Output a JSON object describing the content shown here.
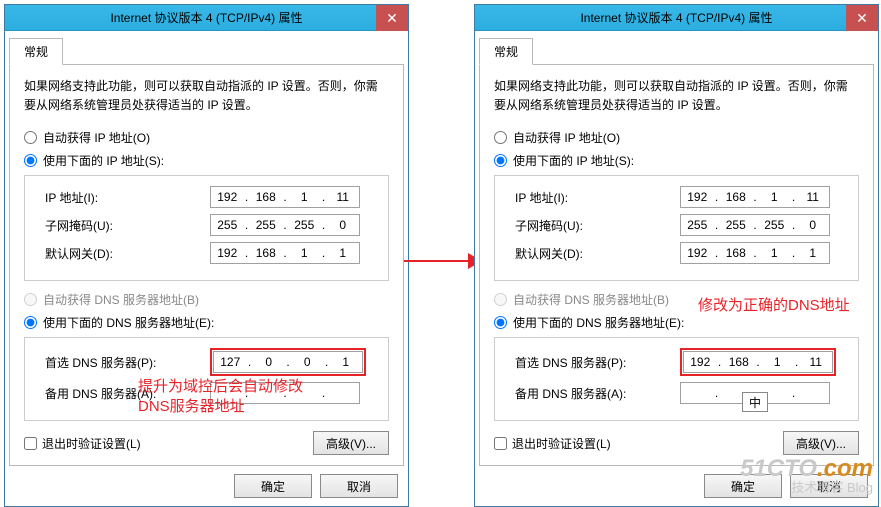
{
  "title": "Internet 协议版本 4 (TCP/IPv4) 属性",
  "tab_general": "常规",
  "desc": "如果网络支持此功能，则可以获取自动指派的 IP 设置。否则，你需要从网络系统管理员处获得适当的 IP 设置。",
  "radio_auto_ip": "自动获得 IP 地址(O)",
  "radio_manual_ip": "使用下面的 IP 地址(S):",
  "lbl_ip": "IP 地址(I):",
  "lbl_mask": "子网掩码(U):",
  "lbl_gateway": "默认网关(D):",
  "radio_auto_dns": "自动获得 DNS 服务器地址(B)",
  "radio_manual_dns": "使用下面的 DNS 服务器地址(E):",
  "lbl_dns1": "首选 DNS 服务器(P):",
  "lbl_dns2": "备用 DNS 服务器(A):",
  "chk_validate": "退出时验证设置(L)",
  "btn_advanced": "高级(V)...",
  "btn_ok": "确定",
  "btn_cancel": "取消",
  "ip": {
    "a": "192",
    "b": "168",
    "c": "1",
    "d": "11"
  },
  "mask": {
    "a": "255",
    "b": "255",
    "c": "255",
    "d": "0"
  },
  "gateway": {
    "a": "192",
    "b": "168",
    "c": "1",
    "d": "1"
  },
  "left": {
    "dns1": {
      "a": "127",
      "b": "0",
      "c": "0",
      "d": "1"
    },
    "caption": "提升为域控后会自动修改\nDNS服务器地址"
  },
  "right": {
    "dns1": {
      "a": "192",
      "b": "168",
      "c": "1",
      "d": "11"
    },
    "caption": "修改为正确的DNS地址"
  },
  "ime": "中",
  "watermark": {
    "brand": "51CTO",
    "domain": ".com",
    "sub": "技术博客 Blog"
  }
}
